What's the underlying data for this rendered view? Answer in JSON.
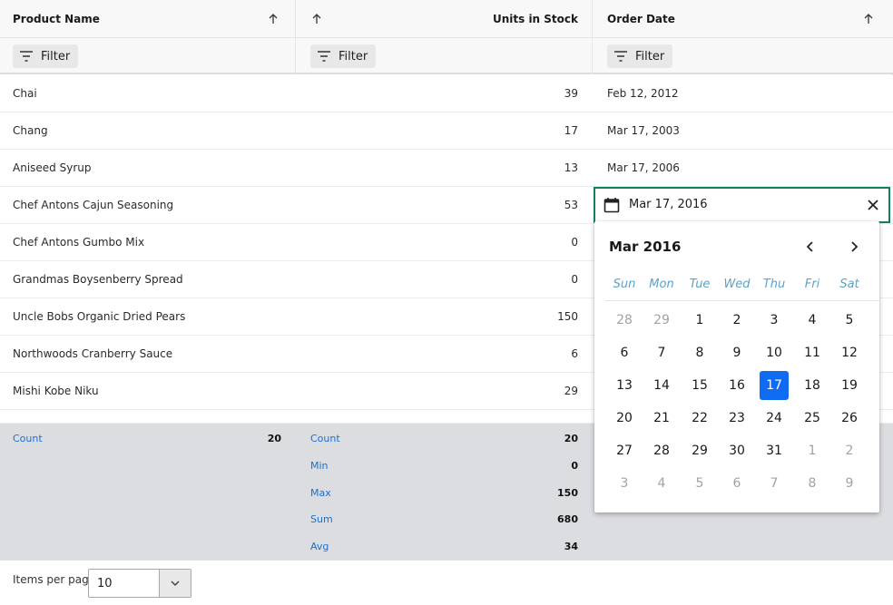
{
  "columns": [
    {
      "label": "Product Name"
    },
    {
      "label": "Units in Stock"
    },
    {
      "label": "Order Date"
    }
  ],
  "filter_label": "Filter",
  "rows": [
    {
      "name": "Chai",
      "units": "39",
      "date": "Feb 12, 2012"
    },
    {
      "name": "Chang",
      "units": "17",
      "date": "Mar 17, 2003"
    },
    {
      "name": "Aniseed Syrup",
      "units": "13",
      "date": "Mar 17, 2006"
    },
    {
      "name": "Chef Antons Cajun Seasoning",
      "units": "53",
      "date": ""
    },
    {
      "name": "Chef Antons Gumbo Mix",
      "units": "0",
      "date": ""
    },
    {
      "name": "Grandmas Boysenberry Spread",
      "units": "0",
      "date": ""
    },
    {
      "name": "Uncle Bobs Organic Dried Pears",
      "units": "150",
      "date": ""
    },
    {
      "name": "Northwoods Cranberry Sauce",
      "units": "6",
      "date": ""
    },
    {
      "name": "Mishi Kobe Niku",
      "units": "29",
      "date": ""
    }
  ],
  "summary": {
    "product_name": [
      {
        "label": "Count",
        "value": "20"
      }
    ],
    "units": [
      {
        "label": "Count",
        "value": "20"
      },
      {
        "label": "Min",
        "value": "0"
      },
      {
        "label": "Max",
        "value": "150"
      },
      {
        "label": "Sum",
        "value": "680"
      },
      {
        "label": "Avg",
        "value": "34"
      }
    ]
  },
  "editor": {
    "value": "Mar 17, 2016"
  },
  "calendar": {
    "title": "Mar 2016",
    "weekdays": [
      "Sun",
      "Mon",
      "Tue",
      "Wed",
      "Thu",
      "Fri",
      "Sat"
    ],
    "weeks": [
      [
        "28",
        "29",
        "1",
        "2",
        "3",
        "4",
        "5"
      ],
      [
        "6",
        "7",
        "8",
        "9",
        "10",
        "11",
        "12"
      ],
      [
        "13",
        "14",
        "15",
        "16",
        "17",
        "18",
        "19"
      ],
      [
        "20",
        "21",
        "22",
        "23",
        "24",
        "25",
        "26"
      ],
      [
        "27",
        "28",
        "29",
        "30",
        "31",
        "1",
        "2"
      ],
      [
        "3",
        "4",
        "5",
        "6",
        "7",
        "8",
        "9"
      ]
    ],
    "selected": "17"
  },
  "pager": {
    "label": "Items per page",
    "value": "10"
  },
  "colors": {
    "accent": "#0f6cf2",
    "editor_border": "#12805c",
    "summary_label": "#1b6fd4",
    "weekday": "#5aa3cc",
    "summary_bg": "#dcdde1"
  },
  "icons": [
    "sort-ascending-icon",
    "filter-icon",
    "calendar-icon",
    "close-icon",
    "chevron-left-icon",
    "chevron-right-icon",
    "chevron-down-icon"
  ]
}
